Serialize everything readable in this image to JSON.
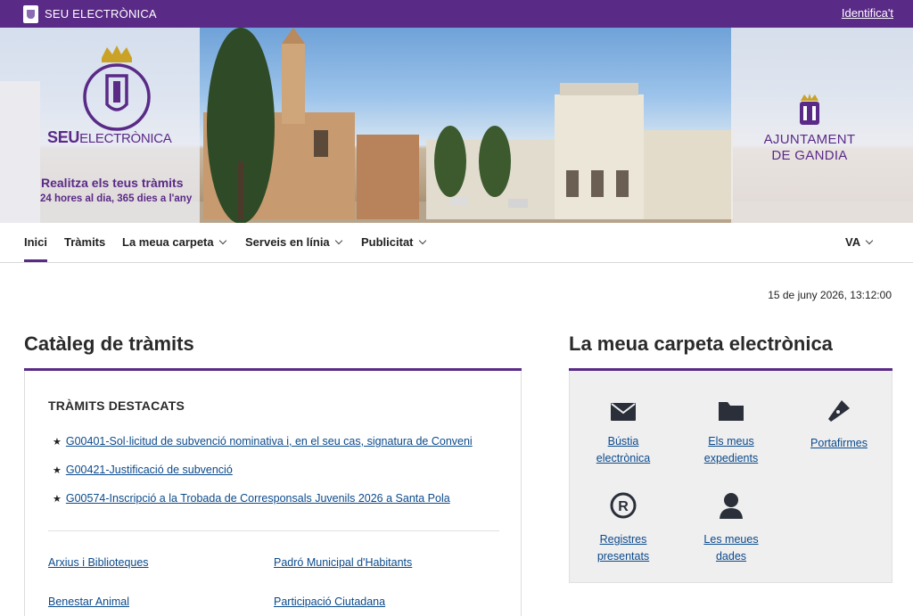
{
  "topbar": {
    "brand": "SEU ELECTRÒNICA",
    "login": "Identifica't"
  },
  "banner": {
    "seu_bold": "SEU",
    "seu_rest": "ELECTRÒNICA",
    "tagline": "Realitza els teus tràmits",
    "tagline2": "24 hores al dia, 365 dies a l'any",
    "ajuntament_line1": "AJUNTAMENT",
    "ajuntament_line2": "DE GANDIA"
  },
  "nav": {
    "items": [
      "Inici",
      "Tràmits",
      "La meua carpeta",
      "Serveis en línia",
      "Publicitat"
    ],
    "language": "VA"
  },
  "datetime": "15 de juny 2026, 13:12:00",
  "catalog": {
    "title": "Catàleg de tràmits",
    "featured_heading": "TRÀMITS DESTACATS",
    "featured": [
      "G00401-Sol·licitud de subvenció nominativa i, en el seu cas, signatura de Conveni",
      "G00421-Justificació de subvenció",
      "G00574-Inscripció a la Trobada de Corresponsals Juvenils 2026 a Santa Pola"
    ],
    "categories": [
      "Arxius i Biblioteques",
      "Padró Municipal d'Habitants",
      "Benestar Animal",
      "Participació Ciutadana"
    ]
  },
  "carpeta": {
    "title": "La meua carpeta electrònica",
    "tiles": [
      {
        "line1": "Bústia",
        "line2": "electrònica",
        "icon": "envelope-icon"
      },
      {
        "line1": "Els meus",
        "line2": "expedients",
        "icon": "folder-icon"
      },
      {
        "line1": "Portafirmes",
        "line2": "",
        "icon": "pen-nib-icon"
      },
      {
        "line1": "Registres",
        "line2": "presentats",
        "icon": "registered-icon"
      },
      {
        "line1": "Les meues",
        "line2": "dades",
        "icon": "user-icon"
      }
    ]
  },
  "colors": {
    "brand": "#5a2a87",
    "link": "#0b4a8b"
  }
}
